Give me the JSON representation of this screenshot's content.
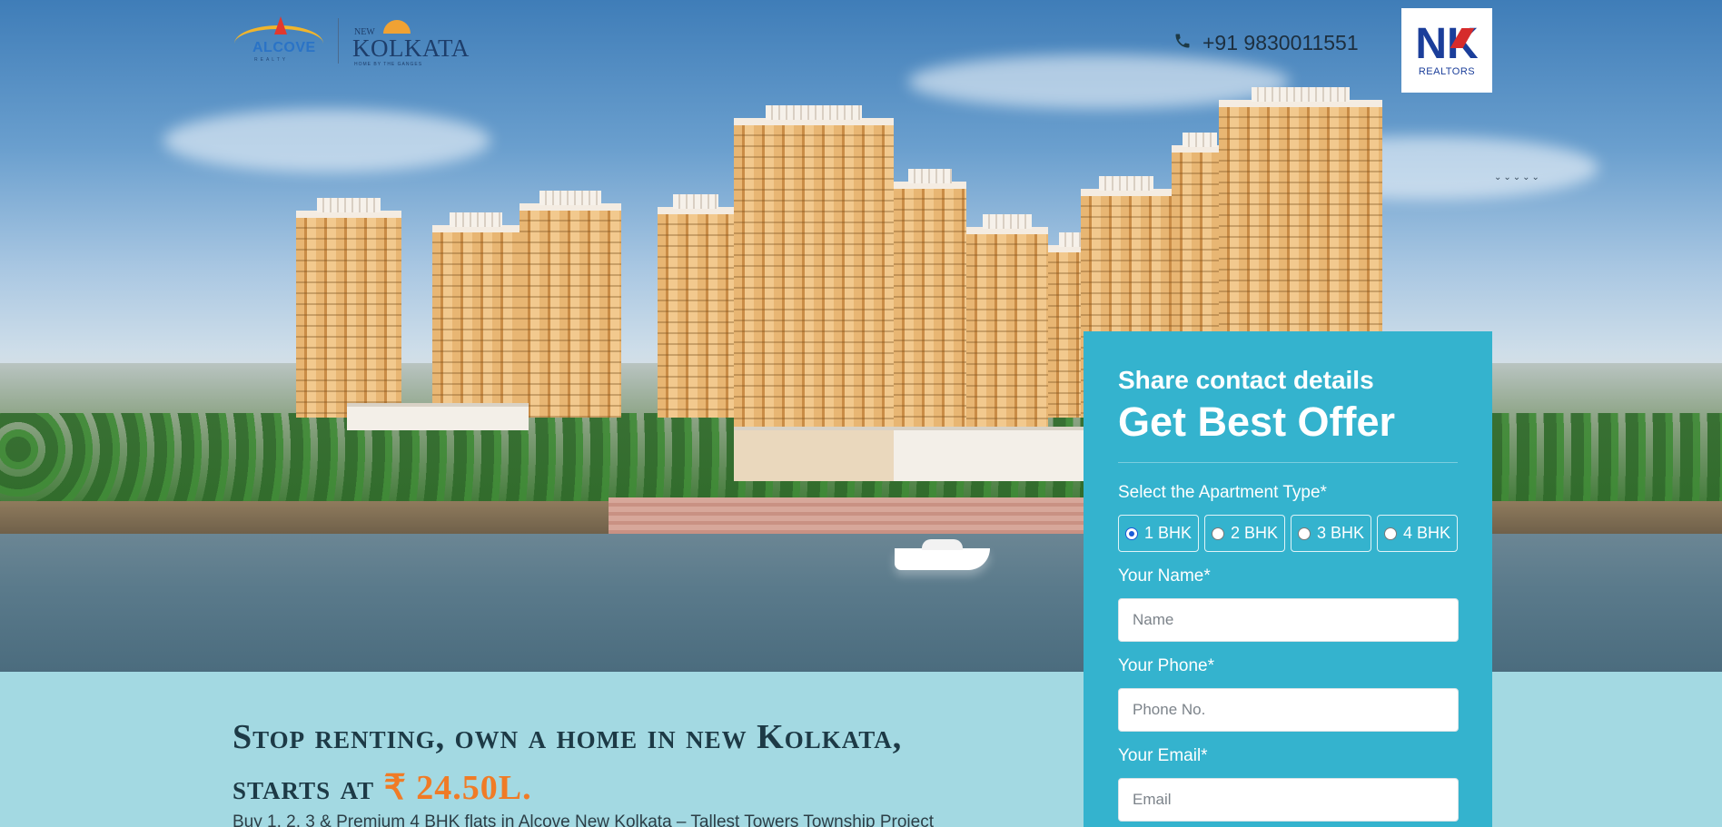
{
  "header": {
    "alcove_logo_text": "ALCOVE",
    "alcove_logo_sub": "REALTY",
    "newkolkata_new": "NEW",
    "newkolkata_name": "KOLKATA",
    "newkolkata_tagline": "HOME BY THE GANGES",
    "phone_icon": "phone-icon",
    "phone_number": "+91 9830011551",
    "realtor_logo_mark": "NK",
    "realtor_logo_text": "REALTORS"
  },
  "form": {
    "pre_title": "Share contact details",
    "title": "Get Best Offer",
    "apartment_label": "Select the Apartment Type*",
    "apartment_options": [
      {
        "label": "1 BHK",
        "selected": true
      },
      {
        "label": "2 BHK",
        "selected": false
      },
      {
        "label": "3 BHK",
        "selected": false
      },
      {
        "label": "4 BHK",
        "selected": false
      }
    ],
    "name_label": "Your Name*",
    "name_placeholder": "Name",
    "phone_label": "Your Phone*",
    "phone_placeholder": "Phone No.",
    "email_label": "Your Email*",
    "email_placeholder": "Email"
  },
  "main": {
    "headline_line1": "Stop renting, own a home in new Kolkata,",
    "headline_line2": "starts at",
    "price": "₹ 24.50L.",
    "subline": "Buy 1, 2, 3 & Premium 4 BHK flats in Alcove New Kolkata – Tallest Towers Township Project"
  },
  "colors": {
    "form_bg": "#34b3ce",
    "page_bg": "#a3d9e2",
    "price_accent": "#f07b26",
    "headline_text": "#1d3a46"
  }
}
